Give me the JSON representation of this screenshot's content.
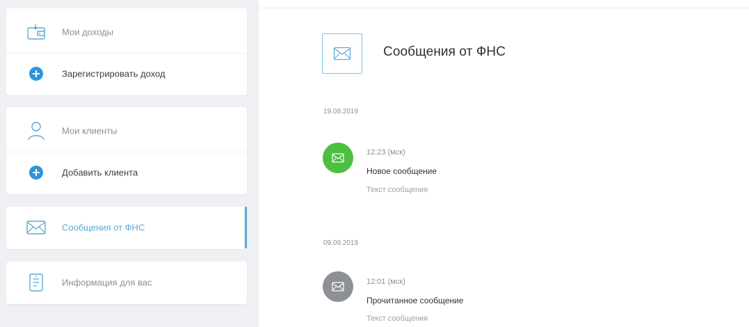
{
  "sidebar": {
    "income": {
      "title": "Мои доходы",
      "action": "Зарегистрировать доход"
    },
    "clients": {
      "title": "Мои клиенты",
      "action": "Добавить клиента"
    },
    "messages": {
      "title": "Сообщения от ФНС"
    },
    "info": {
      "title": "Информация для вас"
    }
  },
  "main": {
    "title": "Сообщения от ФНС",
    "groups": [
      {
        "date": "19.09.2019",
        "messages": [
          {
            "time": "12:23 (мск)",
            "title": "Новое сообщение",
            "text": "Текст сообщения",
            "status": "new"
          }
        ]
      },
      {
        "date": "09.09.2019",
        "messages": [
          {
            "time": "12:01 (мск)",
            "title": "Прочитанное сообщение",
            "text": "Текст сообщения",
            "status": "read"
          }
        ]
      }
    ]
  },
  "colors": {
    "accent": "#5aa9d6",
    "plus": "#2f95d9",
    "new_message": "#4cbf3f",
    "read_message": "#8d9096",
    "sidebar_bg": "#eef0f4"
  },
  "icons": {
    "income": "wallet-icon",
    "add": "plus-circle-icon",
    "clients": "user-icon",
    "messages": "envelope-icon",
    "info": "document-icon"
  }
}
